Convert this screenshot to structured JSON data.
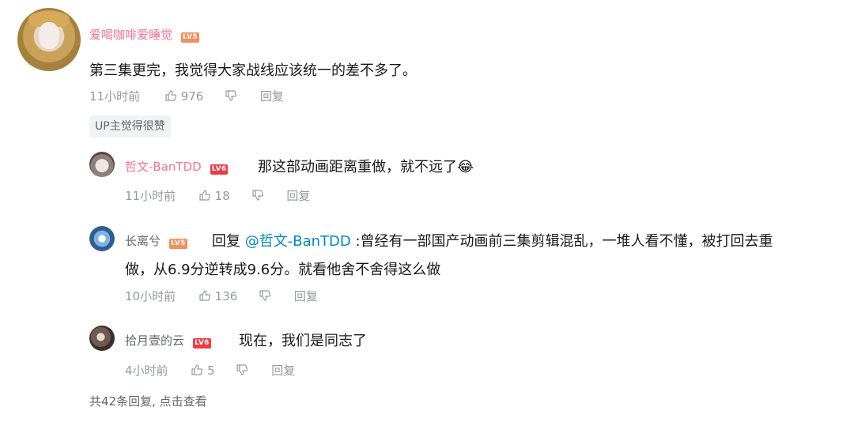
{
  "main_comment": {
    "username": "爱喝咖啡爱睡觉",
    "level": "LV5",
    "text": "第三集更完，我觉得大家战线应该统一的差不多了。",
    "time": "11小时前",
    "likes": "976",
    "reply_label": "回复",
    "tag": "UP主觉得很赞"
  },
  "replies": [
    {
      "username": "哲文-BanTDD",
      "level": "LV6",
      "text": "那这部动画距离重做，就不远了😂",
      "time": "11小时前",
      "likes": "18",
      "reply_label": "回复"
    },
    {
      "username": "长离兮",
      "level": "LV5",
      "reply_prefix": "回复",
      "mention": "@哲文-BanTDD",
      "text_line1": ":曾经有一部国产动画前三集剪辑混乱，一堆人看不懂，被打回去重",
      "text_line2": "做，从6.9分逆转成9.6分。就看他舍不舍得这么做",
      "time": "10小时前",
      "likes": "136",
      "reply_label": "回复"
    },
    {
      "username": "拾月壹的云",
      "level": "LV6",
      "text": "现在，我们是同志了",
      "time": "4小时前",
      "likes": "5",
      "reply_label": "回复"
    }
  ],
  "more_replies": "共42条回复, 点击查看",
  "colors": {
    "username_pink": "#fb7299",
    "meta_gray": "#9499a0",
    "mention_blue": "#008ac5"
  }
}
